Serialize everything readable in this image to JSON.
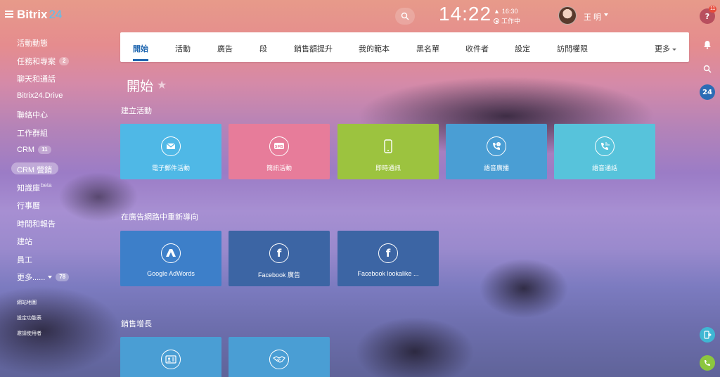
{
  "header": {
    "logo_text": "Bitrix",
    "logo_num": "24",
    "time": "14:22",
    "alarm_time": "16:30",
    "work_status": "工作中",
    "user_name": "王 明"
  },
  "sidebar": {
    "items": [
      {
        "label": "活動動態"
      },
      {
        "label": "任務和專案",
        "badge": "2"
      },
      {
        "label": "聊天和通話"
      },
      {
        "label": "Bitrix24.Drive"
      },
      {
        "label": "聯絡中心"
      },
      {
        "label": "工作群組"
      },
      {
        "label": "CRM",
        "badge": "11"
      },
      {
        "label": "CRM 營銷"
      },
      {
        "label": "知識庫",
        "sup": "beta"
      },
      {
        "label": "行事曆"
      },
      {
        "label": "時間和報告"
      },
      {
        "label": "建站"
      },
      {
        "label": "員工"
      },
      {
        "label": "更多......",
        "badge": "78"
      }
    ],
    "small_items": [
      "網站地圖",
      "設定功能表",
      "邀請使用者"
    ]
  },
  "tabs": [
    {
      "label": "開始"
    },
    {
      "label": "活動"
    },
    {
      "label": "廣告"
    },
    {
      "label": "段"
    },
    {
      "label": "銷售額提升"
    },
    {
      "label": "我的範本"
    },
    {
      "label": "黑名單"
    },
    {
      "label": "收件者"
    },
    {
      "label": "設定"
    },
    {
      "label": "訪問權限"
    },
    {
      "label": "更多"
    }
  ],
  "main": {
    "title": "開始",
    "sections": [
      {
        "title": "建立活動",
        "tiles": [
          {
            "label": "電子郵件活動",
            "icon": "email-icon",
            "color": "#4fb8e6"
          },
          {
            "label": "簡訊活動",
            "icon": "sms-icon",
            "color": "#e77c9a"
          },
          {
            "label": "即時通訊",
            "icon": "mobile-icon",
            "color": "#9cc33f"
          },
          {
            "label": "語音廣播",
            "icon": "voice-broadcast-icon",
            "color": "#4a9ed4"
          },
          {
            "label": "語音通話",
            "icon": "voice-call-icon",
            "color": "#57c3db"
          }
        ]
      },
      {
        "title": "在廣告網路中重新導向",
        "tiles": [
          {
            "label": "Google AdWords",
            "icon": "adwords-icon",
            "color": "#3d7fc9"
          },
          {
            "label": "Facebook 廣告",
            "icon": "facebook-icon",
            "color": "#3c65a4"
          },
          {
            "label": "Facebook lookalike ...",
            "icon": "facebook-icon",
            "color": "#3c65a4"
          }
        ]
      },
      {
        "title": "銷售增長",
        "tiles": [
          {
            "label": "",
            "icon": "contact-card-icon",
            "color": "#4a9ed4"
          },
          {
            "label": "",
            "icon": "handshake-icon",
            "color": "#4a9ed4"
          }
        ]
      }
    ]
  },
  "rightbar": {
    "help_badge": "11",
    "app_label": "24"
  }
}
